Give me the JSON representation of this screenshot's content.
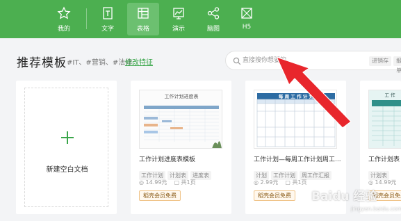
{
  "nav": {
    "items": [
      {
        "label": "我的",
        "icon": "star-icon"
      },
      {
        "label": "文字",
        "icon": "document-icon"
      },
      {
        "label": "表格",
        "icon": "spreadsheet-icon"
      },
      {
        "label": "演示",
        "icon": "presentation-icon"
      },
      {
        "label": "脑图",
        "icon": "mindmap-icon"
      },
      {
        "label": "H5",
        "icon": "h5-icon"
      }
    ],
    "active": "表格"
  },
  "header": {
    "title": "推荐模板",
    "tags": "#IT、#营销、#法律",
    "edit_link": "修改特征"
  },
  "search": {
    "placeholder": "直接搜你想要的",
    "hot_words": [
      "进销存",
      "报销单"
    ]
  },
  "blank_card": {
    "label": "新建空白文档"
  },
  "cards": [
    {
      "title": "工作计划进度表模板",
      "tags": [
        "工作计划",
        "计划表",
        "进度表"
      ],
      "price": "14.99元",
      "pages": "共1页",
      "badge": "稻壳会员免费",
      "thumb_title": "工作计划进度表"
    },
    {
      "title": "工作计划—每周工作计划周工...",
      "tags": [
        "计划",
        "工作计划",
        "周工作汇报"
      ],
      "price": "2.99元",
      "pages": "共1页",
      "badge": "稻壳会员免费",
      "thumb_title": "每 周 工 作 计 划"
    },
    {
      "title": "工作计划表（",
      "tags": [
        "计划表"
      ],
      "price": "14.99元",
      "pages": "",
      "badge": "稻壳会员免费",
      "thumb_title": "工 作"
    }
  ],
  "watermark": {
    "brand": "Baidu 经验",
    "url": "jingyan.baidu.com"
  },
  "colors": {
    "brand_green": "#4caf50",
    "accent_green": "#3aa64a",
    "arrow_red": "#e8262c"
  }
}
